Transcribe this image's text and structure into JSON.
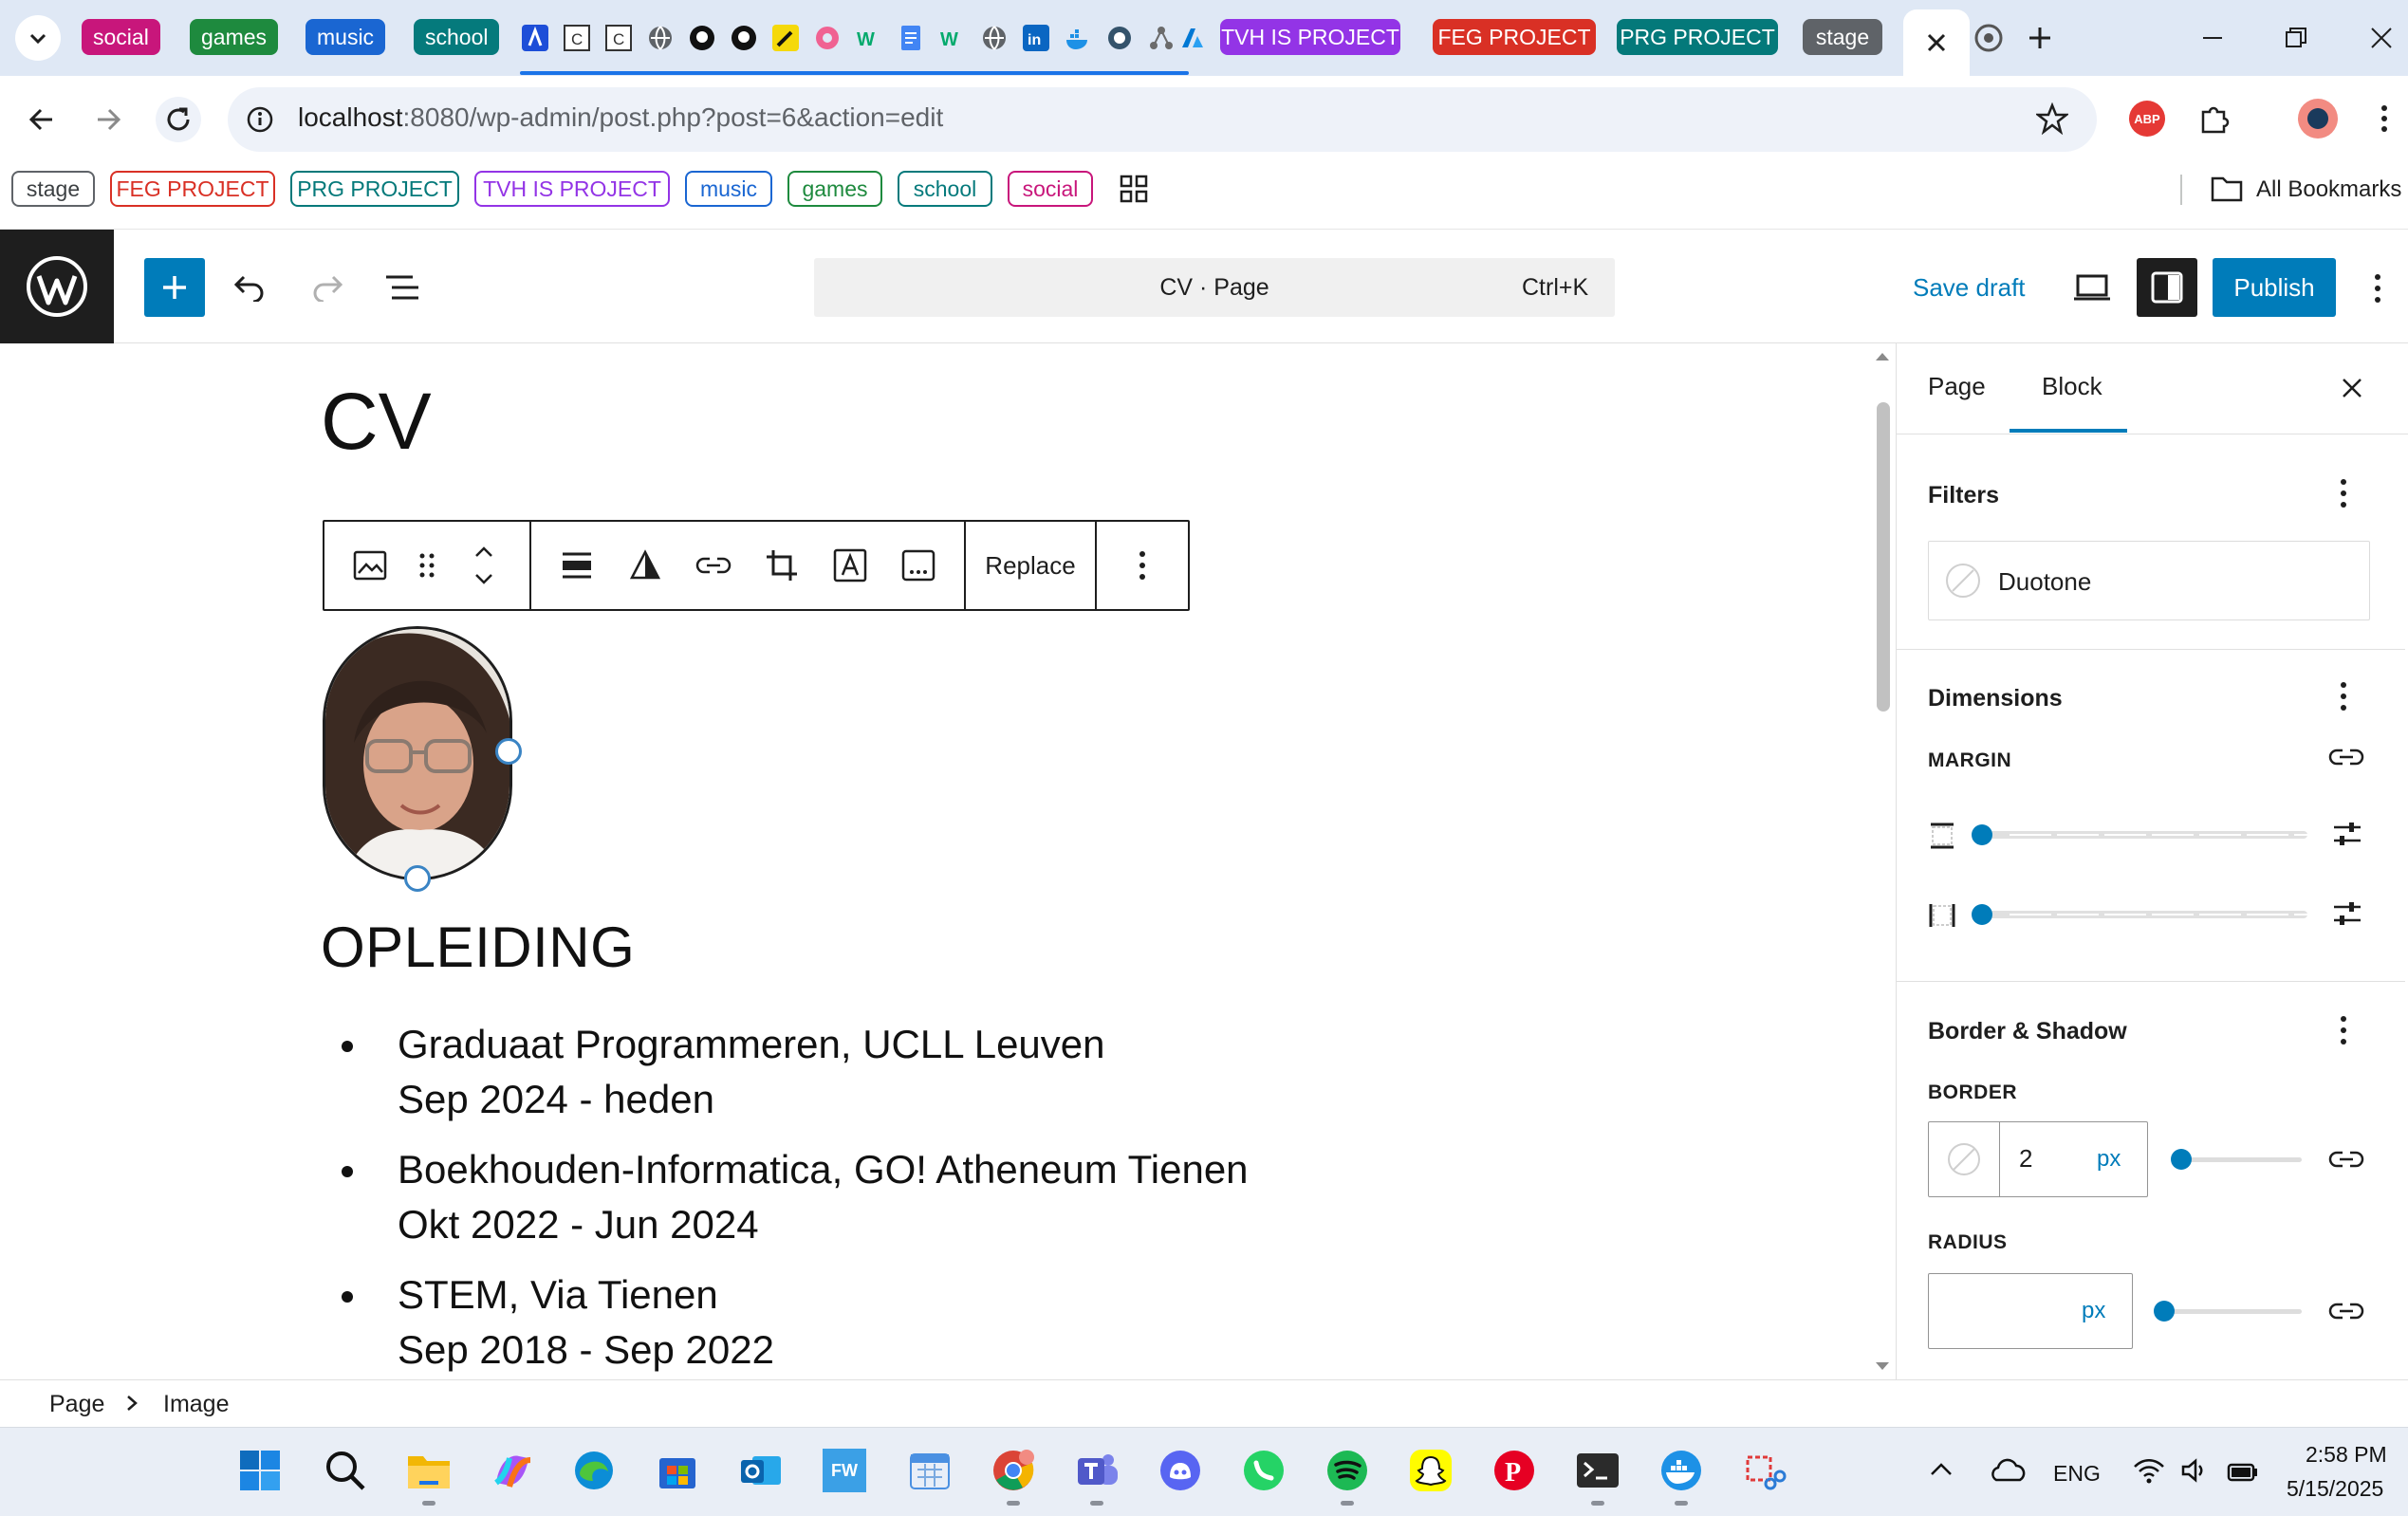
{
  "browser": {
    "tab_groups": [
      {
        "label": "social",
        "color": "#c8167b"
      },
      {
        "label": "games",
        "color": "#1e8a3e"
      },
      {
        "label": "music",
        "color": "#1a66d2"
      },
      {
        "label": "school",
        "color": "#057a7c"
      }
    ],
    "project_tabs": [
      {
        "label": "TVH IS PROJECT",
        "color": "#9334e6"
      },
      {
        "label": "FEG PROJECT",
        "color": "#d93025"
      },
      {
        "label": "PRG PROJECT",
        "color": "#04797a"
      },
      {
        "label": "stage",
        "color": "#5f6368"
      }
    ],
    "url_host": "localhost",
    "url_path": ":8080/wp-admin/post.php?post=6&action=edit",
    "bookmarks": [
      {
        "label": "stage",
        "color": "#5f6368"
      },
      {
        "label": "FEG PROJECT",
        "color": "#d93025"
      },
      {
        "label": "PRG PROJECT",
        "color": "#04797a"
      },
      {
        "label": "TVH IS PROJECT",
        "color": "#9334e6"
      },
      {
        "label": "music",
        "color": "#1a66d2"
      },
      {
        "label": "games",
        "color": "#1e8a3e"
      },
      {
        "label": "school",
        "color": "#057a7c"
      },
      {
        "label": "social",
        "color": "#c8167b"
      }
    ],
    "all_bookmarks": "All Bookmarks",
    "extension_abp": "ABP"
  },
  "editor": {
    "command_title": "CV · Page",
    "command_shortcut": "Ctrl+K",
    "save_draft": "Save draft",
    "publish": "Publish",
    "page_title": "CV",
    "replace": "Replace",
    "heading": "OPLEIDING",
    "education": [
      {
        "title": "Graduaat Programmeren, UCLL Leuven",
        "period": "Sep 2024 - heden"
      },
      {
        "title": "Boekhouden-Informatica, GO! Atheneum Tienen",
        "period": "Okt 2022 - Jun 2024"
      },
      {
        "title": "STEM, Via Tienen",
        "period": "Sep 2018 - Sep 2022"
      }
    ]
  },
  "sidebar": {
    "tab_page": "Page",
    "tab_block": "Block",
    "filters_title": "Filters",
    "duotone_label": "Duotone",
    "dimensions_title": "Dimensions",
    "margin_label": "MARGIN",
    "border_shadow_title": "Border & Shadow",
    "border_label": "BORDER",
    "border_width": "2",
    "border_unit": "px",
    "radius_label": "RADIUS",
    "radius_value": "",
    "radius_unit": "px"
  },
  "breadcrumb": {
    "root": "Page",
    "current": "Image"
  },
  "taskbar": {
    "language": "ENG",
    "time": "2:58 PM",
    "date": "5/15/2025",
    "fw_label": "FW"
  }
}
